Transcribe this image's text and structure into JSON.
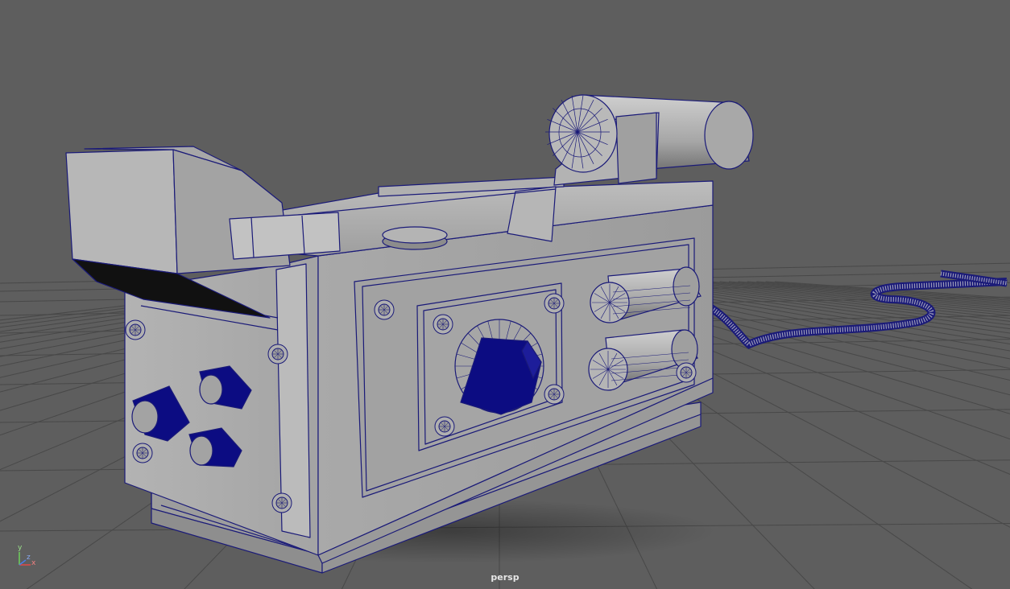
{
  "viewport": {
    "camera_name": "persp",
    "background_color": "#5e5e5e",
    "grid_color": "#474747",
    "wire_color": "#1a1a78",
    "selected_fill": "#0c0c82",
    "model_fill": "#a9a9a9"
  },
  "axis_gizmo": {
    "y": "y",
    "x": "x",
    "z": "z"
  }
}
